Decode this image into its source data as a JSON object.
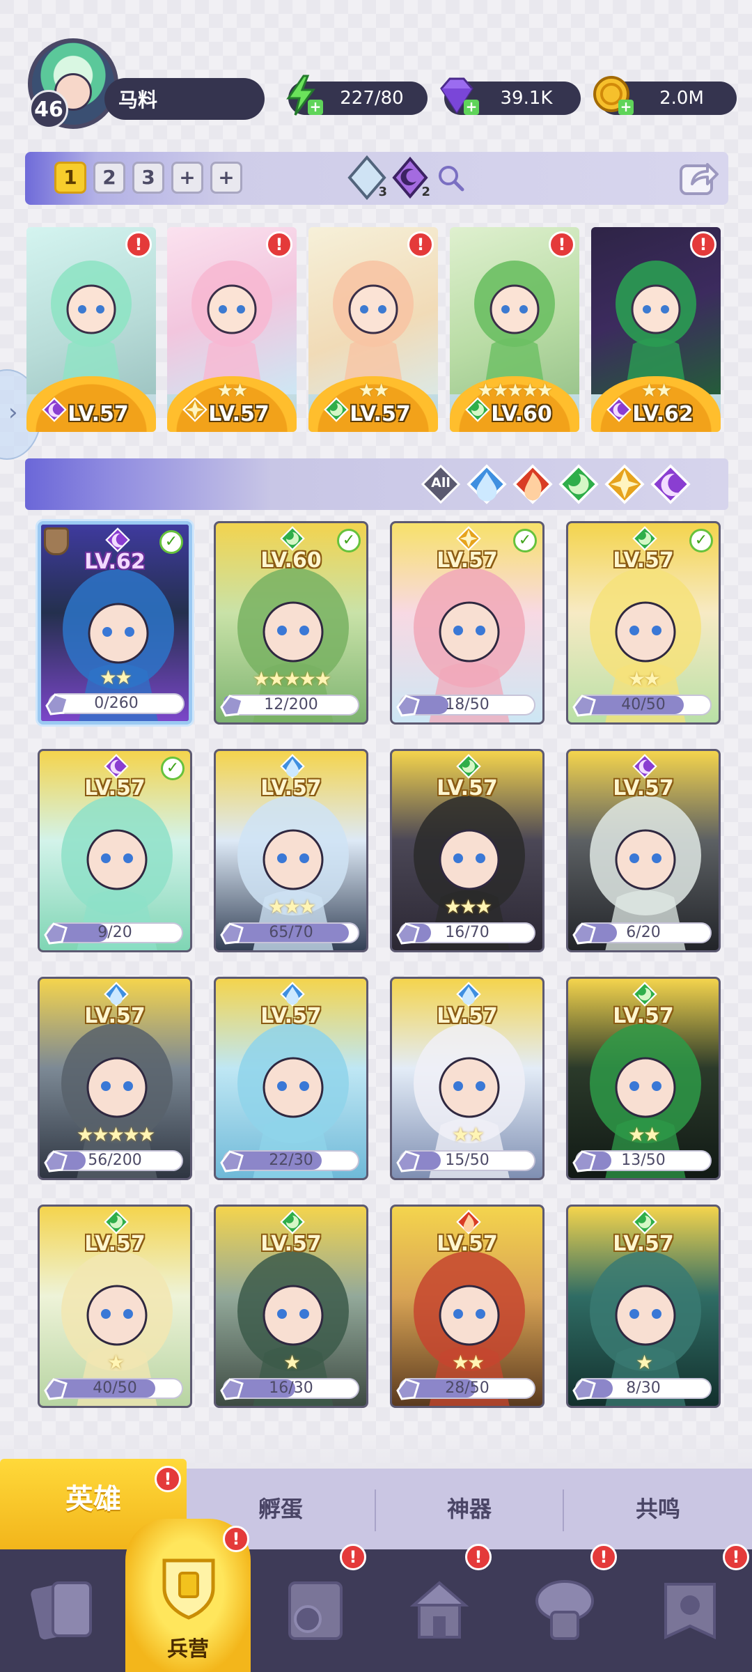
{
  "player": {
    "level": "46",
    "name": "马料"
  },
  "resources": {
    "energy": "227/80",
    "gems": "39.1K",
    "gold": "2.0M"
  },
  "team_tabs": [
    "1",
    "2",
    "3",
    "+",
    "+"
  ],
  "team_summary": {
    "water_count": "3",
    "dark_count": "2"
  },
  "lineup": [
    {
      "level": "LV.57",
      "element": "dark",
      "stars": "",
      "alert": "!"
    },
    {
      "level": "LV.57",
      "element": "light",
      "stars": "★★",
      "alert": "!"
    },
    {
      "level": "LV.57",
      "element": "nature",
      "stars": "★★",
      "alert": "!"
    },
    {
      "level": "LV.60",
      "element": "nature",
      "stars": "★★★★★",
      "alert": "!"
    },
    {
      "level": "LV.62",
      "element": "dark",
      "stars": "★★",
      "alert": "!"
    }
  ],
  "filters": [
    {
      "label": "All",
      "element": "all"
    },
    {
      "label": "",
      "element": "water"
    },
    {
      "label": "",
      "element": "fire"
    },
    {
      "label": "",
      "element": "nature"
    },
    {
      "label": "",
      "element": "light"
    },
    {
      "label": "",
      "element": "dark"
    }
  ],
  "heroes": [
    {
      "level": "LV.62",
      "element": "dark",
      "progress": "0/260",
      "ratio": 0.0,
      "stars": "★★",
      "check": "✓"
    },
    {
      "level": "LV.60",
      "element": "nature",
      "progress": "12/200",
      "ratio": 0.06,
      "stars": "★★★★★",
      "check": "✓"
    },
    {
      "level": "LV.57",
      "element": "light",
      "progress": "18/50",
      "ratio": 0.36,
      "stars": "",
      "check": "✓"
    },
    {
      "level": "LV.57",
      "element": "nature",
      "progress": "40/50",
      "ratio": 0.8,
      "stars": "★★",
      "check": "✓"
    },
    {
      "level": "LV.57",
      "element": "dark",
      "progress": "9/20",
      "ratio": 0.45,
      "stars": "",
      "check": "✓"
    },
    {
      "level": "LV.57",
      "element": "water",
      "progress": "65/70",
      "ratio": 0.93,
      "stars": "★★★",
      "check": ""
    },
    {
      "level": "LV.57",
      "element": "nature",
      "progress": "16/70",
      "ratio": 0.23,
      "stars": "★★★",
      "check": ""
    },
    {
      "level": "LV.57",
      "element": "dark",
      "progress": "6/20",
      "ratio": 0.3,
      "stars": "",
      "check": ""
    },
    {
      "level": "LV.57",
      "element": "water",
      "progress": "56/200",
      "ratio": 0.28,
      "stars": "★★★★★",
      "check": ""
    },
    {
      "level": "LV.57",
      "element": "water",
      "progress": "22/30",
      "ratio": 0.73,
      "stars": "",
      "check": ""
    },
    {
      "level": "LV.57",
      "element": "water",
      "progress": "15/50",
      "ratio": 0.3,
      "stars": "★★",
      "check": ""
    },
    {
      "level": "LV.57",
      "element": "nature",
      "progress": "13/50",
      "ratio": 0.26,
      "stars": "★★",
      "check": ""
    },
    {
      "level": "LV.57",
      "element": "nature",
      "progress": "40/50",
      "ratio": 0.8,
      "stars": "★",
      "check": ""
    },
    {
      "level": "LV.57",
      "element": "nature",
      "progress": "16/30",
      "ratio": 0.53,
      "stars": "★",
      "check": ""
    },
    {
      "level": "LV.57",
      "element": "fire",
      "progress": "28/50",
      "ratio": 0.56,
      "stars": "★★",
      "check": ""
    },
    {
      "level": "LV.57",
      "element": "nature",
      "progress": "8/30",
      "ratio": 0.27,
      "stars": "★",
      "check": ""
    }
  ],
  "sub_tabs": {
    "heroes": "英雄",
    "hatch": "孵蛋",
    "artifact": "神器",
    "resonance": "共鸣"
  },
  "sub_tab_alert": "!",
  "bottom_nav": {
    "barracks_label": "兵营",
    "alert": "!"
  },
  "colors": {
    "water": "#3f8fe0",
    "fire": "#d93c24",
    "nature": "#2fae4a",
    "light": "#e6a31d",
    "dark": "#8a3ed1",
    "all": "#7b7a8c"
  }
}
